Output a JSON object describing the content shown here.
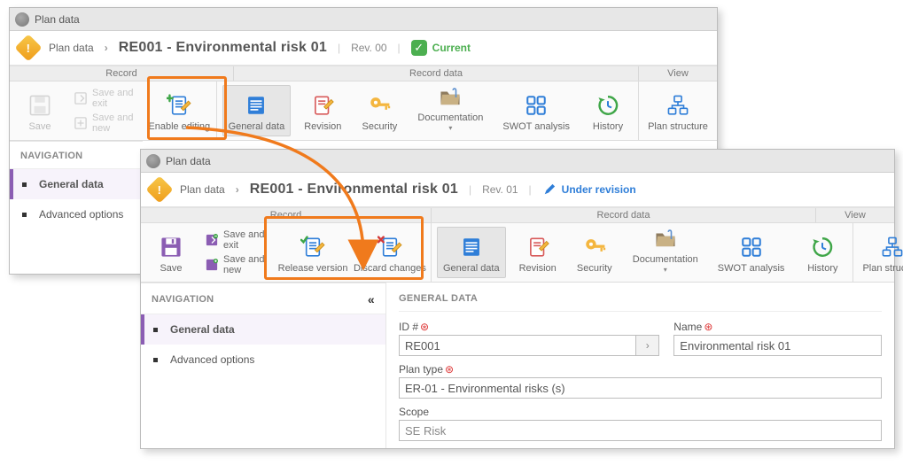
{
  "winA": {
    "title": "Plan data",
    "breadcrumb": {
      "root": "Plan data",
      "title": "RE001 - Environmental risk 01",
      "rev": "Rev. 00",
      "status": "Current"
    },
    "ribbon_heads": {
      "record": "Record",
      "record_data": "Record data",
      "view": "View"
    },
    "ribbon": {
      "save": "Save",
      "save_exit": "Save and exit",
      "save_new": "Save and new",
      "enable_editing": "Enable editing",
      "general_data": "General data",
      "revision": "Revision",
      "security": "Security",
      "documentation": "Documentation",
      "swot": "SWOT analysis",
      "history": "History",
      "plan_structure": "Plan structure"
    },
    "nav": {
      "header": "NAVIGATION",
      "item_general": "General data",
      "item_adv": "Advanced options"
    }
  },
  "winB": {
    "title": "Plan data",
    "breadcrumb": {
      "root": "Plan data",
      "title": "RE001 - Environmental risk 01",
      "rev": "Rev. 01",
      "status": "Under revision"
    },
    "ribbon_heads": {
      "record": "Record",
      "record_data": "Record data",
      "view": "View"
    },
    "ribbon": {
      "save": "Save",
      "save_exit": "Save and exit",
      "save_new": "Save and new",
      "release_version": "Release version",
      "discard_changes": "Discard changes",
      "general_data": "General data",
      "revision": "Revision",
      "security": "Security",
      "documentation": "Documentation",
      "swot": "SWOT analysis",
      "history": "History",
      "plan_structure": "Plan structure"
    },
    "nav": {
      "header": "NAVIGATION",
      "item_general": "General data",
      "item_adv": "Advanced options"
    },
    "form": {
      "header": "GENERAL DATA",
      "id_label": "ID #",
      "id_value": "RE001",
      "name_label": "Name",
      "name_value": "Environmental risk 01",
      "plan_type_label": "Plan type",
      "plan_type_value": "ER-01 - Environmental risks (s)",
      "scope_label": "Scope",
      "scope_value": "SE Risk"
    }
  }
}
